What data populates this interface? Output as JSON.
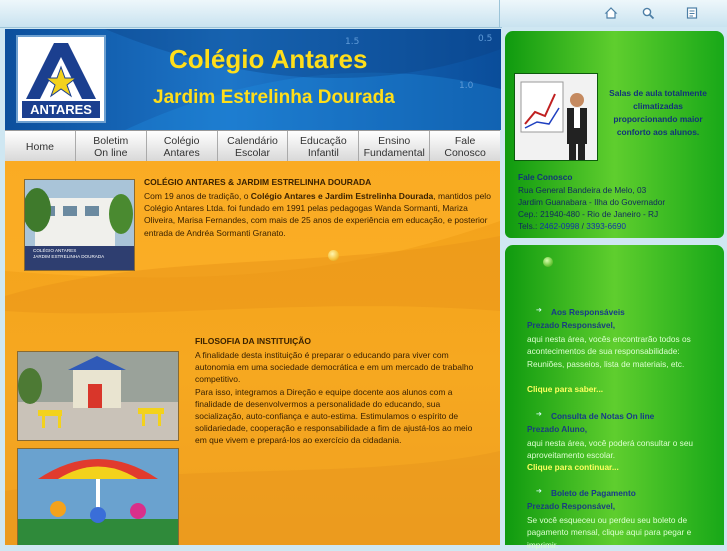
{
  "banner": {
    "title": "Colégio Antares",
    "subtitle": "Jardim Estrelinha Dourada",
    "logo_text": "ANTARES",
    "bg_numbers": [
      "1.5",
      "1.0",
      "0.5"
    ]
  },
  "toolbar": {
    "icons": [
      "home-icon",
      "search-icon",
      "document-icon"
    ]
  },
  "nav": {
    "items": [
      "Home",
      "Boletim\nOn line",
      "Colégio\nAntares",
      "Calendário\nEscolar",
      "Educação\nInfantil",
      "Ensino\nFundamental",
      "Fale\nConosco"
    ]
  },
  "section1": {
    "title": "COLÉGIO ANTARES & JARDIM ESTRELINHA DOURADA",
    "text_a": "Com 19 anos de tradição, o ",
    "text_b": "Colégio Antares e Jardim Estrelinha Dourada",
    "text_c": ", mantidos pelo Colégio Antares Ltda. foi fundado em 1991 pelas pedagogas Wanda Sormanti, Mariza Oliveira, Marisa Fernandes, com mais de 25 anos de experiência em educação, e posterior entrada de Andréa Sormanti Granato.",
    "photo_sign": "COLÉGIO ANTARES\nJARDIM ESTRELINHA DOURADA"
  },
  "section2": {
    "title": "FILOSOFIA DA INSTITUIÇÃO",
    "text": "A finalidade desta instituição é preparar o educando para viver com autonomia em uma sociedade democrática e em um mercado de trabalho competitivo.\nPara isso, integramos a Direção e equipe docente aos alunos com a finalidade de desenvolvermos a personalidade do educando, sua socialização, auto-confiança e auto-estima. Estimulamos o espírito de solidariedade, cooperação e responsabilidade a fim de ajustá-los ao meio em que vivem e prepará-los ao exercício da cidadania."
  },
  "contact": {
    "promo": "Salas de aula totalmente climatizadas proporcionando maior conforto aos alunos.",
    "title": "Fale Conosco",
    "address_1": "Rua General Bandeira de Melo, 03",
    "address_2": "Jardim Guanabara - Ilha do Governador",
    "address_3": "Cep.: 21940-480 - Rio de Janeiro - RJ",
    "phone_label": "Tels.: ",
    "phone_1": "2462-0998",
    "phone_sep": " / ",
    "phone_2": "3393-6690"
  },
  "sidebar": {
    "items": [
      {
        "title": "Aos Responsáveis",
        "greeting": "Prezado Responsável,",
        "text": "aqui nesta área, vocês encontrarão todos os acontecimentos de sua responsabilidade: Reuniões, passeios, lista de materiais, etc.",
        "link": "Clique para saber..."
      },
      {
        "title": "Consulta de Notas On line",
        "greeting": "Prezado Aluno,",
        "text": "aqui nesta área, você poderá consultar o seu aproveitamento escolar.",
        "link": "Clique para continuar..."
      },
      {
        "title": "Boleto de Pagamento",
        "greeting": "Prezado Responsável,",
        "text": "Se você esqueceu ou perdeu seu boleto de pagamento mensal, clique aqui para pegar e imprimir.",
        "link": ""
      }
    ]
  },
  "colors": {
    "banner_blue": "#1a6fc4",
    "title_yellow": "#ffde1a",
    "orange": "#f6a820",
    "green": "#2bb51f"
  }
}
